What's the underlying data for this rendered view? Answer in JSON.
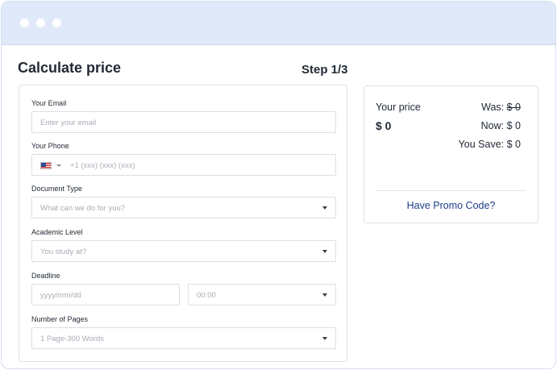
{
  "header": {
    "title": "Calculate price",
    "step": "Step 1/3"
  },
  "form": {
    "email": {
      "label": "Your Email",
      "placeholder": "Enter your email"
    },
    "phone": {
      "label": "Your Phone",
      "placeholder": "+1 (xxx) (xxx) (xxx)",
      "country_icon": "us-flag-icon"
    },
    "document_type": {
      "label": "Document Type",
      "placeholder": "What can we do for you?"
    },
    "academic_level": {
      "label": "Academic Level",
      "placeholder": "You study at?"
    },
    "deadline": {
      "label": "Deadline",
      "date_placeholder": "yyyy/mm/dd",
      "time_placeholder": "00:00"
    },
    "pages": {
      "label": "Number of Pages",
      "placeholder": "1 Page-300 Words"
    }
  },
  "summary": {
    "your_price_label": "Your price",
    "price_value": "$ 0",
    "was_label": "Was:",
    "was_value": "$ 0",
    "now": "Now: $ 0",
    "you_save": "You Save: $ 0",
    "promo_link": "Have Promo Code?"
  }
}
